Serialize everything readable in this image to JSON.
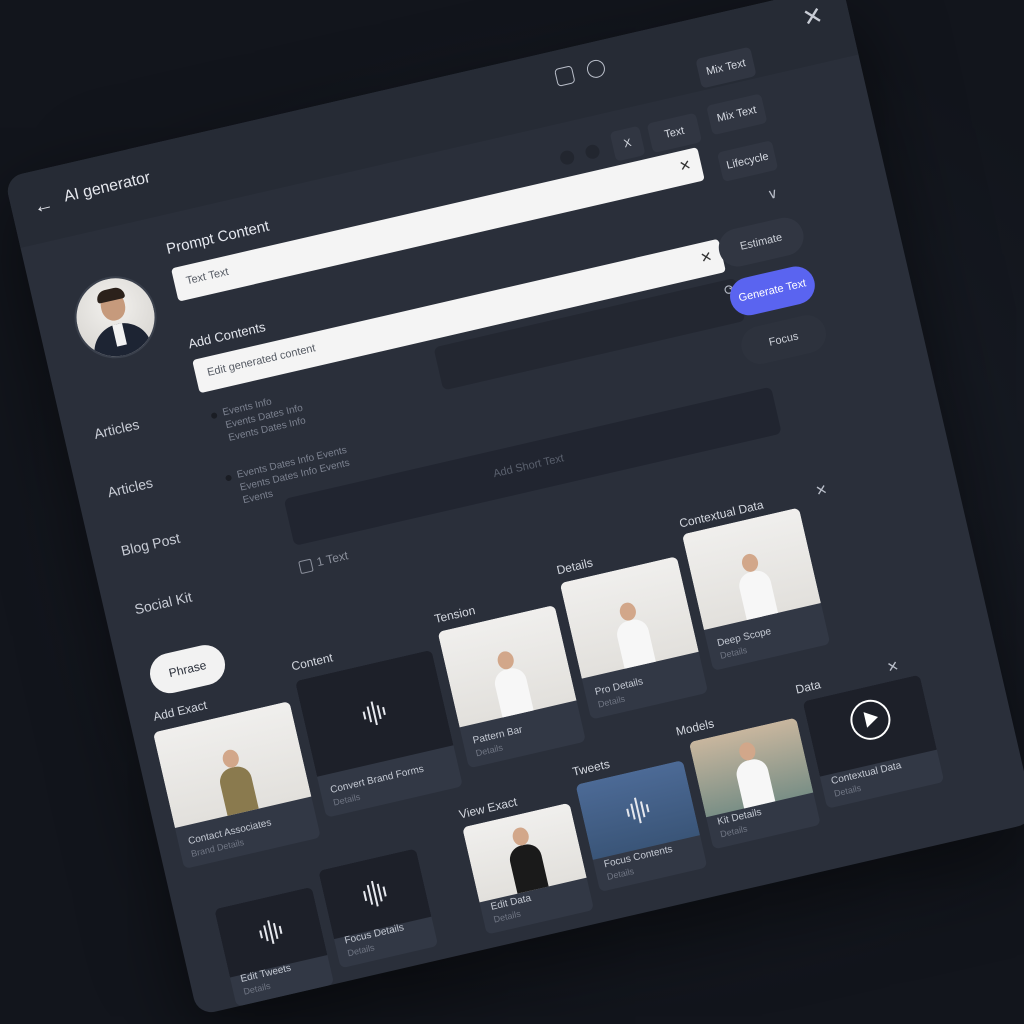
{
  "header": {
    "back_icon": "arrow-left-icon",
    "title": "AI generator",
    "close_icon": "close-icon"
  },
  "sidebar": {
    "items": [
      {
        "label": "Articles"
      },
      {
        "label": "Articles"
      },
      {
        "label": "Blog Post"
      },
      {
        "label": "Social Kit"
      }
    ],
    "button_label": "Phrase"
  },
  "form": {
    "prompt_label": "Prompt Content",
    "prompt_value": "Text Text",
    "context_label": "Add Contents",
    "context_value": "Edit generated content",
    "list_1": "Events Info\nEvents Dates Info\nEvents Dates Info",
    "list_2": "Events Dates Info Events\nEvents Dates Info Events\nEvents",
    "text_placeholder": "Add Short Text",
    "doc_label": "1 Text"
  },
  "right_buttons": {
    "x_label": "X",
    "text_label": "Text",
    "r1": "Mix Text",
    "r2": "Mix Text",
    "r3": "Lifecycle",
    "o1": "Estimate",
    "o2": "Generate Text",
    "o3": "Focus"
  },
  "gallery": {
    "sections": {
      "add_exact": "Add Exact",
      "content": "Content",
      "tension": "Tension",
      "details": "Details",
      "contextual_data": "Contextual Data",
      "view_exact": "View Exact",
      "tweets": "Tweets",
      "models": "Models",
      "data": "Data"
    },
    "cards": [
      {
        "caption": "Contact Associates",
        "sub": "Brand Details"
      },
      {
        "caption": "Convert Brand Forms",
        "sub": "Details"
      },
      {
        "caption": "Pattern Bar",
        "sub": "Details"
      },
      {
        "caption": "Pro Details",
        "sub": "Details"
      },
      {
        "caption": "Deep Scope",
        "sub": "Details"
      },
      {
        "caption": "Edit Data",
        "sub": "Details"
      },
      {
        "caption": "Focus Contents",
        "sub": "Details"
      },
      {
        "caption": "Kit Details",
        "sub": "Details"
      },
      {
        "caption": "Contextual Data",
        "sub": "Details"
      },
      {
        "caption": "Edit Tweets",
        "sub": "Details"
      },
      {
        "caption": "Focus Details",
        "sub": "Details"
      }
    ]
  }
}
